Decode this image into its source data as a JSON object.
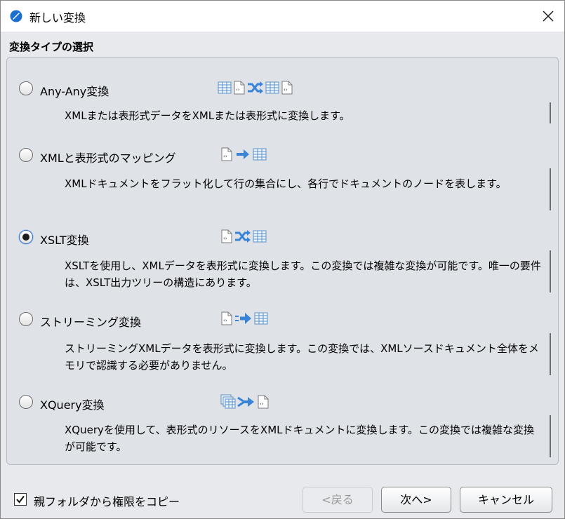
{
  "window": {
    "title": "新しい変換"
  },
  "section_header": "変換タイプの選択",
  "options": [
    {
      "label": "Any-Any変換",
      "description": "XMLまたは表形式データをXMLまたは表形式に変換します。",
      "selected": false,
      "icons": [
        "table-icon",
        "xml-doc-icon",
        "shuffle-arrows-icon",
        "table-icon",
        "xml-doc-icon"
      ]
    },
    {
      "label": "XMLと表形式のマッピング",
      "description": "XMLドキュメントをフラット化して行の集合にし、各行でドキュメントのノードを表します。",
      "selected": false,
      "icons": [
        "xml-doc-icon",
        "right-arrow-icon",
        "table-icon"
      ]
    },
    {
      "label": "XSLT変換",
      "description": "XSLTを使用し、XMLデータを表形式に変換します。この変換では複雑な変換が可能です。唯一の要件は、XSLT出力ツリーの構造にあります。",
      "selected": true,
      "icons": [
        "xml-doc-icon",
        "shuffle-arrows-icon",
        "table-icon"
      ]
    },
    {
      "label": "ストリーミング変換",
      "description": "ストリーミングXMLデータを表形式に変換します。この変換では、XMLソースドキュメント全体をメモリで認識する必要がありません。",
      "selected": false,
      "icons": [
        "xml-doc-icon",
        "stream-arrow-icon",
        "table-icon"
      ]
    },
    {
      "label": "XQuery変換",
      "description": "XQueryを使用して、表形式のリソースをXMLドキュメントに変換します。この変換では複雑な変換が可能です。",
      "selected": false,
      "icons": [
        "stacked-tables-icon",
        "merge-arrow-icon",
        "xml-doc-icon"
      ]
    }
  ],
  "footer": {
    "copy_permissions_label": "親フォルダから権限をコピー",
    "copy_permissions_checked": true,
    "back_label": "<戻る",
    "next_label": "次へ>",
    "cancel_label": "キャンセル"
  },
  "colors": {
    "panel_bg": "#dfe3e8",
    "window_bg": "#e7e9ec",
    "icon_blue": "#3a84d8"
  }
}
